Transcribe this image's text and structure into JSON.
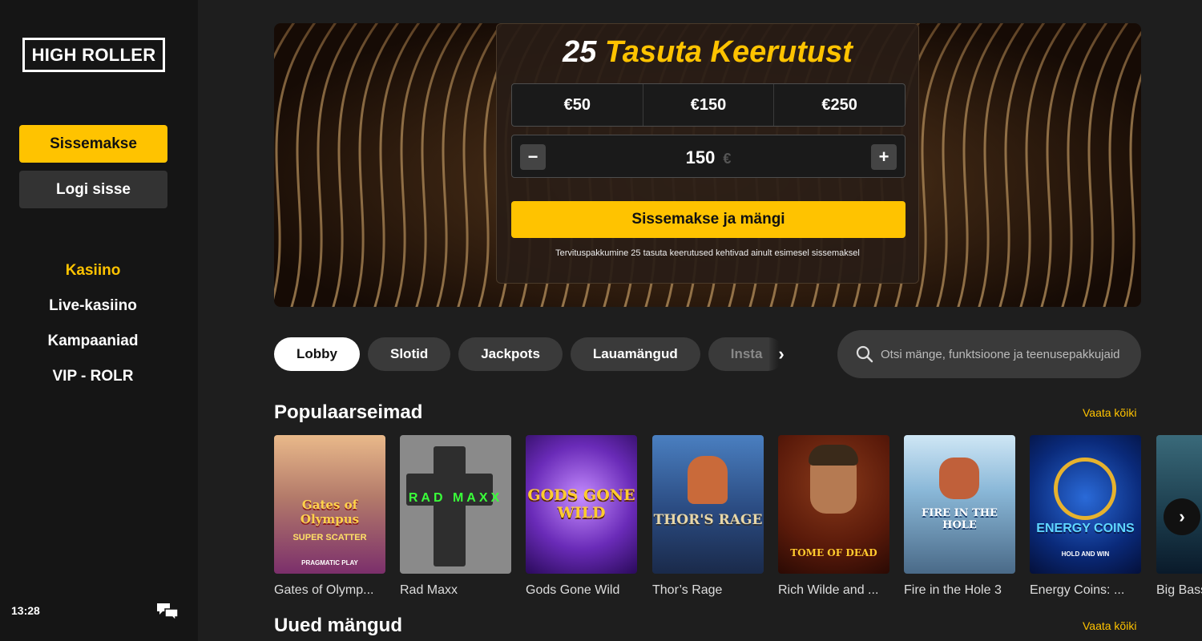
{
  "sidebar": {
    "logo": "HIGH ROLLER",
    "deposit_label": "Sissemakse",
    "login_label": "Logi sisse",
    "nav": [
      "Kasiino",
      "Live-kasiino",
      "Kampaaniad",
      "VIP - ROLR"
    ],
    "active_nav": "Kasiino",
    "clock": "13:28"
  },
  "promo": {
    "title_number": "25",
    "title_text": "Tasuta Keerutust",
    "amounts": [
      "€50",
      "€150",
      "€250"
    ],
    "stepper_value": "150",
    "stepper_currency": "€",
    "minus": "−",
    "plus": "+",
    "cta_label": "Sissemakse ja mängi",
    "note": "Tervituspakkumine 25 tasuta keerutused kehtivad ainult esimesel sissemaksel"
  },
  "filters": {
    "pills": [
      "Lobby",
      "Slotid",
      "Jackpots",
      "Lauamängud",
      "Insta"
    ],
    "active": "Lobby"
  },
  "search": {
    "placeholder": "Otsi mänge, funktsioone ja teenusepakkujaid"
  },
  "sections": {
    "popular": {
      "title": "Populaarseimad",
      "see_all": "Vaata kõiki",
      "games": [
        {
          "label": "Gates of Olymp...",
          "tile_text": "Gates of Olympus",
          "tile_sub": "SUPER SCATTER",
          "provider": "PRAGMATIC PLAY"
        },
        {
          "label": "Rad Maxx",
          "tile_text": "RAD MAXX"
        },
        {
          "label": "Gods Gone Wild",
          "tile_text": "GODS GONE WILD"
        },
        {
          "label": "Thor’s Rage",
          "tile_text": "THOR'S RAGE"
        },
        {
          "label": "Rich Wilde and ...",
          "tile_text": "TOME OF DEAD"
        },
        {
          "label": "Fire in the Hole 3",
          "tile_text": "FIRE IN THE HOLE"
        },
        {
          "label": "Energy Coins: ...",
          "tile_text": "ENERGY COINS",
          "tile_sub": "HOLD AND WIN"
        },
        {
          "label": "Big Bass"
        }
      ]
    },
    "new": {
      "title": "Uued mängud",
      "see_all": "Vaata kõiki"
    }
  },
  "colors": {
    "accent": "#ffc300",
    "sidebar_bg": "#151515",
    "main_bg": "#1e1e1e",
    "pill_bg": "#3a3a3a"
  },
  "icons": {
    "chat": "chat-bubbles-icon",
    "search": "search-icon",
    "next": "chevron-right-icon"
  }
}
